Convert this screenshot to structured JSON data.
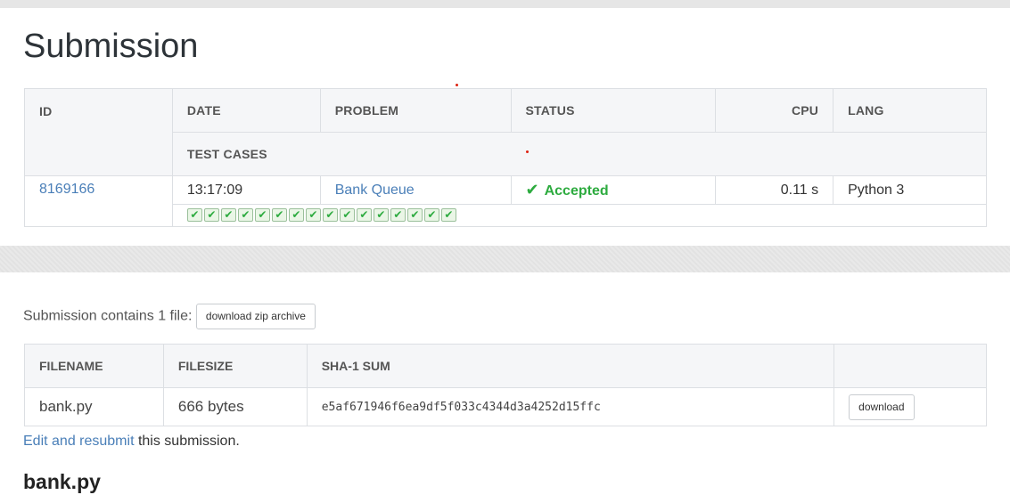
{
  "page": {
    "title": "Submission"
  },
  "submission_table": {
    "headers": {
      "id": "ID",
      "date": "DATE",
      "problem": "PROBLEM",
      "status": "STATUS",
      "cpu": "CPU",
      "lang": "LANG",
      "test_cases": "TEST CASES"
    },
    "row": {
      "id": "8169166",
      "date": "13:17:09",
      "problem": "Bank Queue",
      "status": "Accepted",
      "cpu": "0.11 s",
      "lang": "Python 3"
    },
    "test_cases_passed": 16,
    "test_cases_total": 16
  },
  "files_section": {
    "intro": "Submission contains 1 file:",
    "zip_button": "download zip archive",
    "headers": {
      "filename": "FILENAME",
      "filesize": "FILESIZE",
      "sha1": "SHA-1 SUM"
    },
    "files": [
      {
        "filename": "bank.py",
        "filesize": "666 bytes",
        "sha1": "e5af671946f6ea9df5f033c4344d3a4252d15ffc",
        "download": "download"
      }
    ]
  },
  "resubmit": {
    "link": "Edit and resubmit",
    "rest": " this submission."
  },
  "file_heading": "bank.py",
  "colors": {
    "accent_link": "#4a7fb8",
    "accepted": "#2dab3f"
  }
}
